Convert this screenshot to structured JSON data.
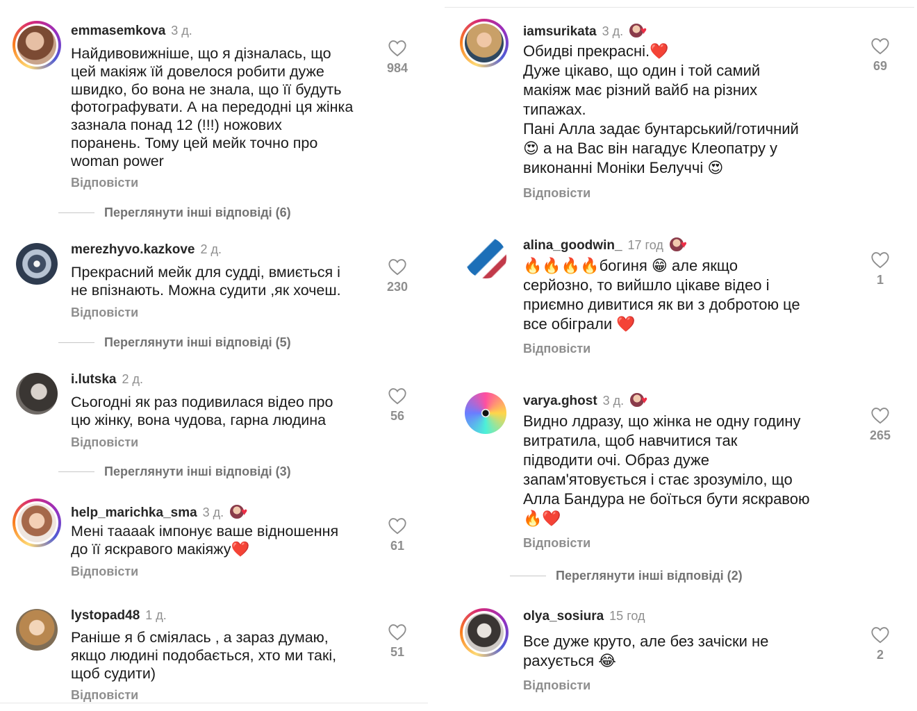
{
  "left_comments": [
    {
      "username": "emmasemkova",
      "time": "3 д.",
      "text": "Найдивовижніше, що я дізналась, що\nцей макіяж їй довелося робити дуже\nшвидко, бо вона не знала, що її будуть\nфотографувати. А на передодні ця жінка\nзазнала понад 12 (!!!) ножових\nпоранень. Тому цей мейк точно про\nwoman power",
      "likes": "984",
      "reply": "Відповісти",
      "more_replies": "Переглянути інші відповіді (6)"
    },
    {
      "username": "merezhyvo.kazkove",
      "time": "2 д.",
      "text": "Прекрасний мейк для судді, вмиється і\nне впізнають. Можна судити ,як хочеш.",
      "likes": "230",
      "reply": "Відповісти",
      "more_replies": "Переглянути інші відповіді (5)"
    },
    {
      "username": "i.lutska",
      "time": "2 д.",
      "text": "Сьогодні як раз подивилася відео про\nцю жінку, вона чудова, гарна людина",
      "likes": "56",
      "reply": "Відповісти",
      "more_replies": "Переглянути інші відповіді (3)"
    },
    {
      "username": "help_marichka_sma",
      "time": "3 д.",
      "text": "Мені тааааk імпонує ваше відношення\nдо її яскравого макіяжу❤️",
      "likes": "61",
      "reply": "Відповісти"
    },
    {
      "username": "lystopad48",
      "time": "1 д.",
      "text": "Раніше я б сміялась , а зараз думаю,\nякщо людині подобається, хто ми такі,\nщоб судити)",
      "likes": "51",
      "reply": "Відповісти"
    }
  ],
  "right_comments": [
    {
      "username": "iamsurikata",
      "time": "3 д.",
      "text": "Обидві прекрасні.❤️\nДуже цікаво, що один і той самий\nмакіяж має різний вайб на різних\nтипажах.\nПані Алла задає бунтарський/готичний\n😍 а на Вас він нагадує Клеопатру у\nвиконанні Моніки Белуччі 😍",
      "likes": "69",
      "reply": "Відповісти"
    },
    {
      "username": "alina_goodwin_",
      "time": "17 год",
      "text": "🔥🔥🔥🔥богиня 😁 але якщо\nсерйозно, то вийшло цікаве відео і\nприємно дивитися як ви з добротою це\nвсе обіграли ❤️",
      "likes": "1",
      "reply": "Відповісти"
    },
    {
      "username": "varya.ghost",
      "time": "3 д.",
      "text": "Видно лдразу, що жінка не одну годину\nвитратила, щоб навчитися так\nпідводити очі. Образ дуже\nзапам'ятовується і стає зрозуміло, що\nАлла Бандура не боїться бути яскравою\n🔥❤️",
      "likes": "265",
      "reply": "Відповісти",
      "more_replies": "Переглянути інші відповіді (2)"
    },
    {
      "username": "olya_sosiura",
      "time": "15 год",
      "text": "Все дуже круто, але без зачіски не\nрахується 😂",
      "likes": "2",
      "reply": "Відповісти"
    }
  ]
}
